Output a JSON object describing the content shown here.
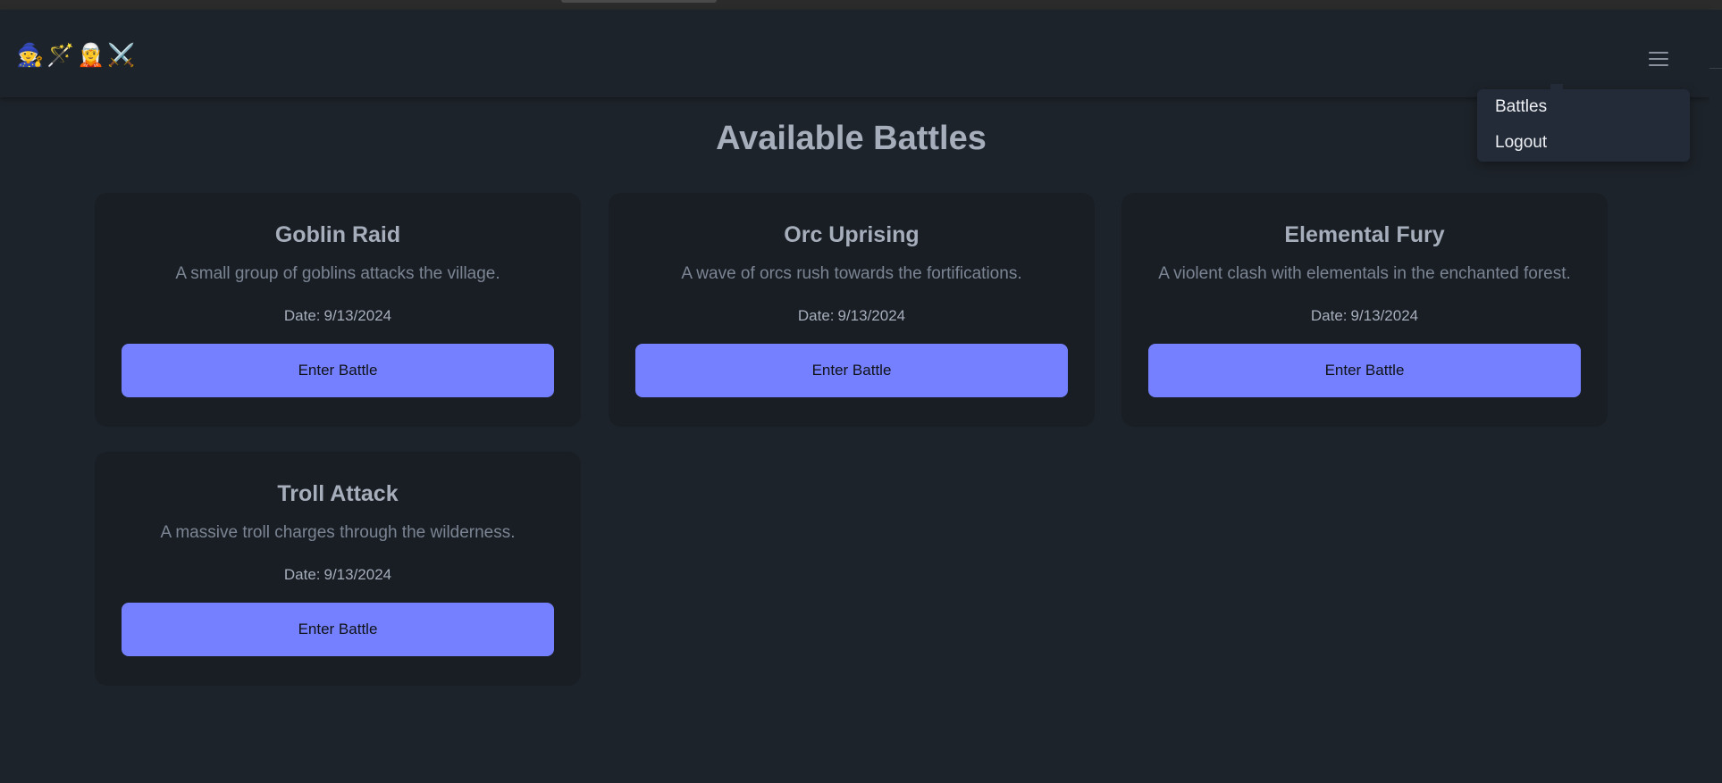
{
  "navbar": {
    "logo_icons": [
      "🧙",
      "🪄",
      "🧝",
      "⚔️"
    ],
    "logo_icon_names": [
      "wizard-icon",
      "magic-wand-icon",
      "elf-icon",
      "crossed-swords-icon"
    ],
    "menu_icon": "hamburger-menu-icon"
  },
  "dropdown": {
    "items": [
      {
        "label": "Battles"
      },
      {
        "label": "Logout"
      }
    ]
  },
  "page": {
    "title": "Available Battles"
  },
  "battles": [
    {
      "title": "Goblin Raid",
      "description": "A small group of goblins attacks the village.",
      "date_label": "Date:",
      "date": "9/13/2024",
      "button_label": "Enter Battle"
    },
    {
      "title": "Orc Uprising",
      "description": "A wave of orcs rush towards the fortifications.",
      "date_label": "Date:",
      "date": "9/13/2024",
      "button_label": "Enter Battle"
    },
    {
      "title": "Elemental Fury",
      "description": "A violent clash with elementals in the enchanted forest.",
      "date_label": "Date:",
      "date": "9/13/2024",
      "button_label": "Enter Battle"
    },
    {
      "title": "Troll Attack",
      "description": "A massive troll charges through the wilderness.",
      "date_label": "Date:",
      "date": "9/13/2024",
      "button_label": "Enter Battle"
    }
  ],
  "colors": {
    "background": "#1d232a",
    "card": "#191e24",
    "primary_button": "#7480ff",
    "heading_text": "#a6adbb",
    "muted_text": "#7c8594"
  }
}
